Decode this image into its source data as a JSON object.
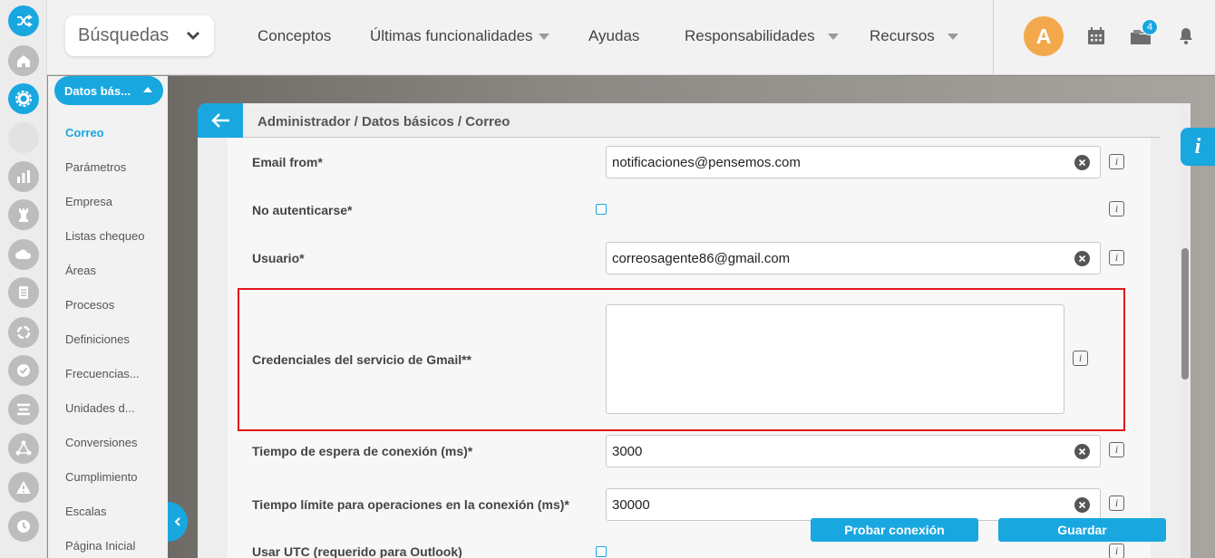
{
  "topbar": {
    "search_label": "Búsquedas",
    "menu": [
      {
        "label": "Conceptos"
      },
      {
        "label": "Últimas funcionalidades"
      },
      {
        "label": "Ayudas"
      },
      {
        "label": "Responsabilidades"
      },
      {
        "label": "Recursos"
      }
    ],
    "avatar_initial": "A",
    "notification_count": "4"
  },
  "sidebar": {
    "section_title": "Datos bás...",
    "items": [
      {
        "label": "Correo"
      },
      {
        "label": "Parámetros"
      },
      {
        "label": "Empresa"
      },
      {
        "label": "Listas chequeo"
      },
      {
        "label": "Áreas"
      },
      {
        "label": "Procesos"
      },
      {
        "label": "Definiciones"
      },
      {
        "label": "Frecuencias..."
      },
      {
        "label": "Unidades d..."
      },
      {
        "label": "Conversiones"
      },
      {
        "label": "Cumplimiento"
      },
      {
        "label": "Escalas"
      },
      {
        "label": "Página Inicial"
      }
    ]
  },
  "page": {
    "breadcrumb": "Administrador / Datos básicos / Correo"
  },
  "form": {
    "email_from": {
      "label": "Email from*",
      "value": "notificaciones@pensemos.com"
    },
    "no_auth": {
      "label": "No autenticarse*",
      "checked": false
    },
    "usuario": {
      "label": "Usuario*",
      "value": "correosagente86@gmail.com"
    },
    "gmail_credentials": {
      "label": "Credenciales del servicio de Gmail**",
      "value": ""
    },
    "connection_timeout": {
      "label": "Tiempo de espera de conexión (ms)*",
      "value": "3000"
    },
    "operation_timeout": {
      "label": "Tiempo límite para operaciones en la conexión (ms)*",
      "value": "30000"
    },
    "use_utc": {
      "label": "Usar UTC (requerido para Outlook)",
      "checked": false
    }
  },
  "actions": {
    "test_label": "Probar conexión",
    "save_label": "Guardar"
  },
  "colors": {
    "accent": "#19a7e0",
    "avatar": "#f3a94b",
    "highlight": "#e0161c"
  }
}
